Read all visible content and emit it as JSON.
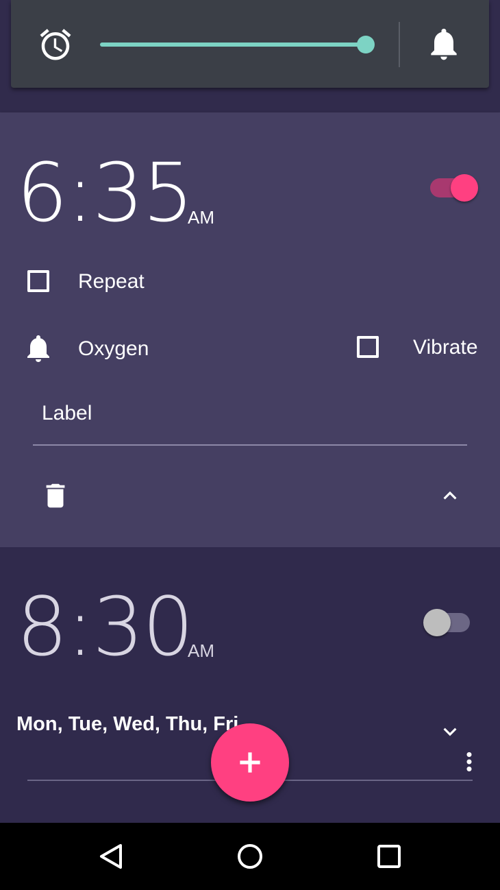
{
  "colors": {
    "accent": "#ff4081",
    "volume": "#7dd3c4",
    "card_expanded": "#453f62",
    "card_collapsed": "#302a4c",
    "volume_panel": "#3b3f47"
  },
  "volume_panel": {
    "left_icon": "alarm-clock-icon",
    "right_icon": "bell-icon",
    "level_fraction": 1.0
  },
  "alarms": [
    {
      "time": "6:35",
      "period": "AM",
      "enabled": true,
      "expanded": true,
      "repeat_label": "Repeat",
      "repeat_checked": false,
      "ringtone": "Oxygen",
      "vibrate_label": "Vibrate",
      "vibrate_checked": false,
      "label_placeholder": "Label",
      "delete_icon": "trash-icon",
      "collapse_icon": "chevron-up-icon"
    },
    {
      "time": "8:30",
      "period": "AM",
      "enabled": false,
      "expanded": false,
      "days": "Mon, Tue, Wed, Thu, Fri",
      "expand_icon": "chevron-down-icon",
      "menu_icon": "more-vertical-icon"
    }
  ],
  "fab": {
    "icon": "plus-icon"
  },
  "nav": {
    "back_icon": "back-icon",
    "home_icon": "home-icon",
    "recents_icon": "recents-icon"
  }
}
